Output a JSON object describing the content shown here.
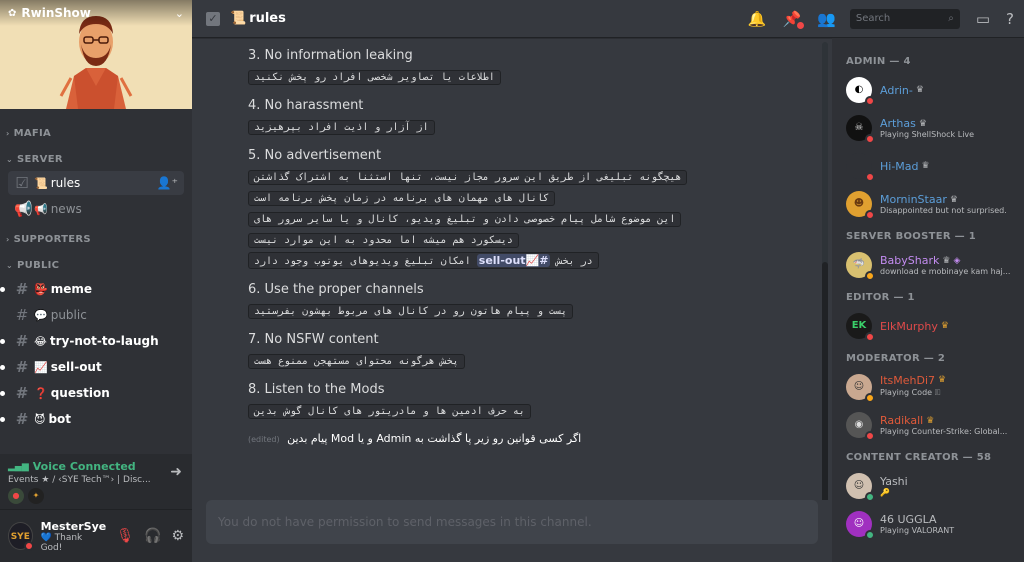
{
  "server": {
    "name": "RwinShow",
    "icon": "✿",
    "chevron": "⌄"
  },
  "categories": {
    "mafia": "MAFIA",
    "server": "SERVER",
    "supporters": "SUPPORTERS",
    "public": "PUBLIC"
  },
  "channels": {
    "rules": {
      "emoji": "📜",
      "name": "rules"
    },
    "news": {
      "emoji": "📢",
      "name": "news"
    },
    "meme": {
      "emoji": "👺",
      "name": "meme"
    },
    "public": {
      "emoji": "💬",
      "name": "public"
    },
    "laugh": {
      "emoji": "😂",
      "name": "try-not-to-laugh"
    },
    "sellout": {
      "emoji": "📈",
      "name": "sell-out"
    },
    "question": {
      "emoji": "❓",
      "name": "question"
    },
    "bot": {
      "emoji": "😈",
      "name": "bot"
    }
  },
  "voice": {
    "title": "Voice Connected",
    "subtitle": "Events ★ / ‹SYE Tech™› | Disc..."
  },
  "user": {
    "name": "MesterSye",
    "status": "💙 Thank God!",
    "avatar_text": "SYE"
  },
  "header": {
    "channel_emoji": "📜",
    "channel_name": "rules",
    "search_placeholder": "Search"
  },
  "rules": {
    "r3": {
      "title": "3. No information leaking",
      "text": "اطلاعات یا تصاویر شخصی افراد رو پخش نکنید"
    },
    "r4": {
      "title": "4. No harassment",
      "text": "از آزار و اذیت افراد بپرهیزید"
    },
    "r5": {
      "title": "5. No advertisement",
      "l1": "هیچگونه تبلیغی از طریق این سرور مجاز نیست، تنها استثنا به اشتراک گذاشتن",
      "l2": "کانال های مهمان های برنامه در زمان پخش برنامه است",
      "l3": "این موضوع شامل پیام خصوصی دادن و تبلیغ ویدیو، کانال و یا سایر سرور های",
      "l4": "دیسکورد هم میشه اما محدود به این موارد نیست",
      "l5a": "امکان تبلیغ ویدیوهای یوتوب وجود دارد",
      "l5b": "در بخش",
      "mention": "#📈sell-out"
    },
    "r6": {
      "title": "6. Use the proper channels",
      "text": "پست و پیام هاتون رو در کانال های مربوط بهشون بفرستید"
    },
    "r7": {
      "title": "7. No NSFW content",
      "text": "پخش هرگونه محتوای مستهجن ممنوع هست"
    },
    "r8": {
      "title": "8. Listen to the Mods",
      "text": "به حرف ادمین ها و مادریتور های کانال گوش بدین"
    },
    "final": "اگر کسی قوانین رو زیر پا گذاشت به Admin و یا Mod پیام بدین",
    "edited": "(edited)"
  },
  "composer": {
    "placeholder": "You do not have permission to send messages in this channel."
  },
  "members": {
    "admin_title": "ADMIN — 4",
    "booster_title": "SERVER BOOSTER — 1",
    "editor_title": "EDITOR — 1",
    "moderator_title": "MODERATOR — 2",
    "creator_title": "CONTENT CREATOR — 58",
    "list": {
      "adrin": {
        "name": "Adrin-",
        "activity": ""
      },
      "arthas": {
        "name": "Arthas",
        "activity": "Playing ShellShock Live"
      },
      "himad": {
        "name": "Hi-Mad",
        "activity": ""
      },
      "morninstaar": {
        "name": "MorninStaar",
        "activity": "Disappointed but not surprised."
      },
      "babyshark": {
        "name": "BabyShark",
        "activity": "download e mobinaye kam haj..."
      },
      "elkmurphy": {
        "name": "ElkMurphy",
        "activity": ""
      },
      "itsmehdi": {
        "name": "ItsMehDi7",
        "activity": "Playing Code 🗉"
      },
      "radikall": {
        "name": "Radikall",
        "activity": "Playing Counter-Strike: Global..."
      },
      "yashi": {
        "name": "Yashi",
        "activity": "🔑"
      },
      "uggla": {
        "name": "46 UGGLA",
        "activity": "Playing VALORANT"
      }
    }
  },
  "colors": {
    "admin": "#5c9ed9",
    "booster": "#c38cf0",
    "editor": "#e04a4a",
    "moderator": "#e05a3a",
    "creator": "#b9bbbe"
  }
}
